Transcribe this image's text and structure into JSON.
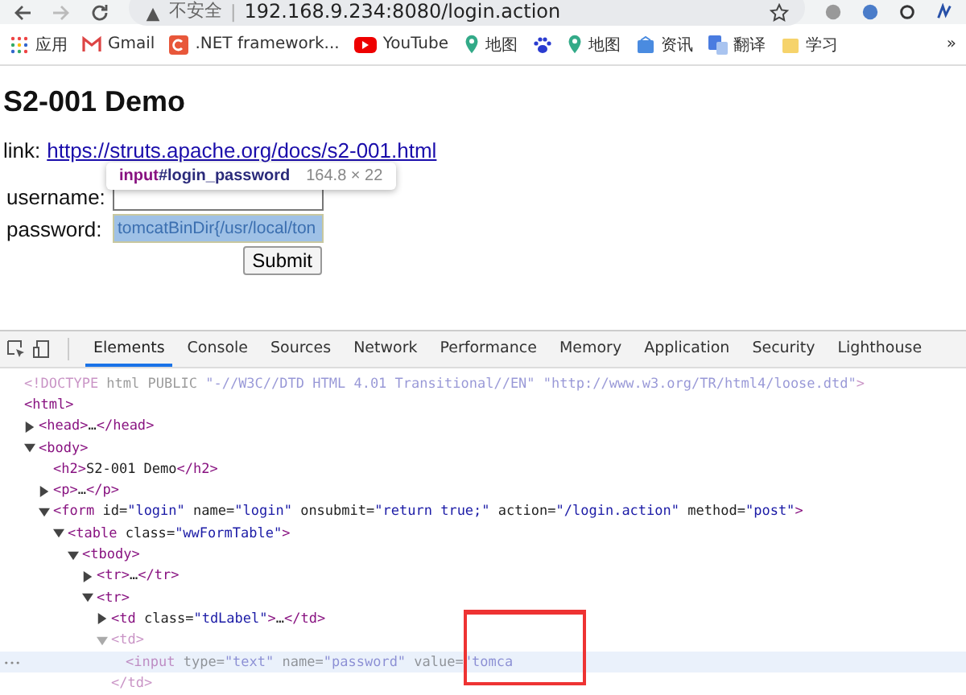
{
  "address_bar": {
    "security": "不安全",
    "separator": "|",
    "url": "192.168.9.234:8080/login.action"
  },
  "bookmarks": [
    {
      "label": "应用",
      "kind": "apps"
    },
    {
      "label": "Gmail",
      "kind": "mail"
    },
    {
      "label": ".NET framework...",
      "kind": "square"
    },
    {
      "label": "YouTube",
      "kind": "play"
    },
    {
      "label": "地图",
      "kind": "pin"
    },
    {
      "kind": "paw"
    },
    {
      "label": "地图",
      "kind": "pin"
    },
    {
      "label": "资讯",
      "kind": "news"
    },
    {
      "label": "翻译",
      "kind": "translate"
    },
    {
      "label": "学习",
      "kind": "folder"
    }
  ],
  "bookmarks_more": "»",
  "page": {
    "heading": "S2-001 Demo",
    "link_label": "link:",
    "link": "https://struts.apache.org/docs/s2-001.html",
    "fields": [
      {
        "label": "username:",
        "highlighted": false
      },
      {
        "label": "password:",
        "value": "tomcatBinDir{/usr/local/ton",
        "highlighted": true
      }
    ],
    "submit": "Submit",
    "tooltip": {
      "selector_tag": "input",
      "selector_id": "#login_password",
      "size": "164.8 × 22"
    }
  },
  "devtools": {
    "tabs": [
      {
        "label": "Elements",
        "selected": true
      },
      {
        "label": "Console",
        "selected": false
      },
      {
        "label": "Sources",
        "selected": false
      },
      {
        "label": "Network",
        "selected": false
      },
      {
        "label": "Performance",
        "selected": false
      },
      {
        "label": "Memory",
        "selected": false
      },
      {
        "label": "Application",
        "selected": false
      },
      {
        "label": "Security",
        "selected": false
      },
      {
        "label": "Lighthouse",
        "selected": false
      }
    ],
    "tree": [
      {
        "text": "<!DOCTYPE html PUBLIC \"-//W3C//DTD HTML 4.01 Transitional//EN\" \"http://www.w3.org/TR/html4/loose.dtd\">",
        "selected": false,
        "dimmed": true
      },
      {
        "text": "<html>",
        "selected": false,
        "dimmed": false,
        "children": [
          {
            "text": "<head>…</head>",
            "expanded": false,
            "selected": false,
            "dimmed": false
          },
          {
            "text": "<body>",
            "expanded": true,
            "selected": false,
            "dimmed": false,
            "children": [
              {
                "text": "<h2>S2-001 Demo</h2>",
                "selected": false,
                "dimmed": false
              },
              {
                "text": "<p>…</p>",
                "expanded": false,
                "selected": false,
                "dimmed": false
              },
              {
                "text": "<form id=\"login\" name=\"login\" onsubmit=\"return true;\" action=\"/login.action\" method=\"post\">",
                "expanded": true,
                "selected": false,
                "dimmed": false,
                "children": [
                  {
                    "text": "<table class=\"wwFormTable\">",
                    "expanded": true,
                    "selected": false,
                    "dimmed": false,
                    "children": [
                      {
                        "text": "<tbody>",
                        "expanded": true,
                        "selected": false,
                        "dimmed": false,
                        "children": [
                          {
                            "text": "<tr>…</tr>",
                            "expanded": false,
                            "selected": false,
                            "dimmed": false
                          },
                          {
                            "text": "<tr>",
                            "expanded": true,
                            "selected": false,
                            "dimmed": false,
                            "children": [
                              {
                                "text": "<td class=\"tdLabel\">…</td>",
                                "expanded": false,
                                "selected": false,
                                "dimmed": false
                              },
                              {
                                "text": "<td>",
                                "expanded": true,
                                "selected": false,
                                "dimmed": true,
                                "children": [
                                  {
                                    "text": "<input type=\"text\" name=\"password\" value=\"tomca",
                                    "selected": true,
                                    "dimmed": true
                                  }
                                ]
                              },
                              {
                                "text": "</td>",
                                "selected": false,
                                "dimmed": true
                              }
                            ]
                          }
                        ]
                      }
                    ]
                  }
                ]
              }
            ]
          }
        ]
      }
    ]
  }
}
